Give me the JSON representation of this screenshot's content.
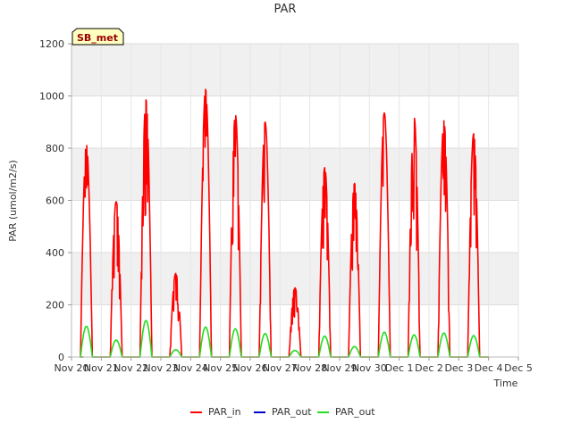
{
  "chart_data": {
    "type": "line",
    "title": "PAR",
    "xlabel": "Time",
    "ylabel": "PAR (umol/m2/s)",
    "station_label": "SB_met",
    "xlim": [
      "Nov 20",
      "Dec 5"
    ],
    "ylim": [
      0,
      1200
    ],
    "yticks": [
      0,
      200,
      400,
      600,
      800,
      1000,
      1200
    ],
    "xticks": [
      "Nov 20",
      "Nov 21",
      "Nov 22",
      "Nov 23",
      "Nov 24",
      "Nov 25",
      "Nov 26",
      "Nov 27",
      "Nov 28",
      "Nov 29",
      "Nov 30",
      "Dec 1",
      "Dec 2",
      "Dec 3",
      "Dec 4",
      "Dec 5"
    ],
    "grid": true,
    "legend_position": "bottom-center",
    "colors": {
      "PAR_in": "#ff0000",
      "PAR_out_blue": "#0000cc",
      "PAR_out_green": "#22dd22",
      "band": "#f0f0f0"
    },
    "series": [
      {
        "name": "PAR_in",
        "color": "#ff0000",
        "daily_peaks": [
          {
            "day": "Nov 20",
            "peak": 815
          },
          {
            "day": "Nov 21",
            "peak": 595
          },
          {
            "day": "Nov 22",
            "peak": 985
          },
          {
            "day": "Nov 23",
            "peak": 320
          },
          {
            "day": "Nov 24",
            "peak": 1025
          },
          {
            "day": "Nov 25",
            "peak": 930
          },
          {
            "day": "Nov 26",
            "peak": 900
          },
          {
            "day": "Nov 27",
            "peak": 265
          },
          {
            "day": "Nov 28",
            "peak": 725
          },
          {
            "day": "Nov 29",
            "peak": 665
          },
          {
            "day": "Nov 30",
            "peak": 935
          },
          {
            "day": "Dec 1",
            "peak": 920
          },
          {
            "day": "Dec 2",
            "peak": 905
          },
          {
            "day": "Dec 3",
            "peak": 855
          }
        ]
      },
      {
        "name": "PAR_out",
        "color": "#0000cc",
        "daily_peaks": []
      },
      {
        "name": "PAR_out",
        "color": "#22dd22",
        "daily_peaks": [
          {
            "day": "Nov 20",
            "peak": 118
          },
          {
            "day": "Nov 21",
            "peak": 65
          },
          {
            "day": "Nov 22",
            "peak": 140
          },
          {
            "day": "Nov 23",
            "peak": 28
          },
          {
            "day": "Nov 24",
            "peak": 115
          },
          {
            "day": "Nov 25",
            "peak": 108
          },
          {
            "day": "Nov 26",
            "peak": 90
          },
          {
            "day": "Nov 27",
            "peak": 25
          },
          {
            "day": "Nov 28",
            "peak": 80
          },
          {
            "day": "Nov 29",
            "peak": 40
          },
          {
            "day": "Nov 30",
            "peak": 95
          },
          {
            "day": "Dec 1",
            "peak": 85
          },
          {
            "day": "Dec 2",
            "peak": 92
          },
          {
            "day": "Dec 3",
            "peak": 82
          }
        ]
      }
    ]
  }
}
